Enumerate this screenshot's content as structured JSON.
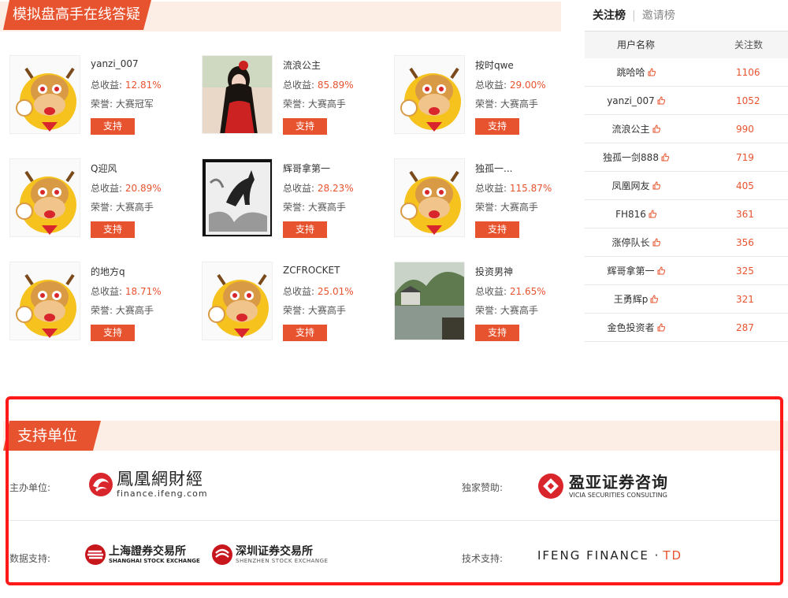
{
  "section_title": "模拟盘高手在线答疑",
  "labels": {
    "gain": "总收益:",
    "honor": "荣誉:"
  },
  "support_label": "支持",
  "cards": [
    {
      "name": "yanzi_007",
      "gain": "12.81%",
      "honor": "大赛冠军",
      "avatar": "cow-mascot"
    },
    {
      "name": "流浪公主",
      "gain": "85.89%",
      "honor": "大赛高手",
      "avatar": "photo-woman"
    },
    {
      "name": "按时qwe",
      "gain": "29.00%",
      "honor": "大赛高手",
      "avatar": "cow-mascot"
    },
    {
      "name": "Q迎风",
      "gain": "20.89%",
      "honor": "大赛高手",
      "avatar": "cow-mascot"
    },
    {
      "name": "辉哥拿第一",
      "gain": "28.23%",
      "honor": "大赛高手",
      "avatar": "horse-painting"
    },
    {
      "name": "独孤一...",
      "gain": "115.87%",
      "honor": "大赛高手",
      "avatar": "cow-mascot"
    },
    {
      "name": "的地方q",
      "gain": "18.71%",
      "honor": "大赛高手",
      "avatar": "cow-mascot"
    },
    {
      "name": "ZCFROCKET",
      "gain": "25.01%",
      "honor": "大赛高手",
      "avatar": "cow-mascot"
    },
    {
      "name": "投资男神",
      "gain": "21.65%",
      "honor": "大赛高手",
      "avatar": "photo-river"
    }
  ],
  "ranking": {
    "tab_active": "关注榜",
    "tab_other": "邀请榜",
    "col_name": "用户名称",
    "col_count": "关注数",
    "rows": [
      {
        "name": "跳哈哈",
        "count": "1106"
      },
      {
        "name": "yanzi_007",
        "count": "1052"
      },
      {
        "name": "流浪公主",
        "count": "990"
      },
      {
        "name": "独孤一剑888",
        "count": "719"
      },
      {
        "name": "凤凰网友",
        "count": "405"
      },
      {
        "name": "FH816",
        "count": "361"
      },
      {
        "name": "涨停队长",
        "count": "356"
      },
      {
        "name": "辉哥拿第一",
        "count": "325"
      },
      {
        "name": "王勇辉p",
        "count": "321"
      },
      {
        "name": "金色投资者",
        "count": "287"
      }
    ]
  },
  "support": {
    "title": "支持单位",
    "host_label": "主办单位:",
    "sponsor_label": "独家赞助:",
    "data_label": "数据支持:",
    "tech_label": "技术支持:",
    "ifeng_logo": "鳳凰網財經",
    "ifeng_url": "finance.ifeng.com",
    "vicia_logo": "盈亚证券咨询",
    "vicia_en": "VICIA SECURITIES CONSULTING",
    "sse_logo": "上海證券交易所",
    "sse_en": "SHANGHAI STOCK EXCHANGE",
    "szse_logo": "深圳证券交易所",
    "szse_en": "SHENZHEN STOCK EXCHANGE",
    "tech_logo_a": "IFENG FINANCE · ",
    "tech_logo_b": "TD"
  },
  "colors": {
    "accent": "#e8532f",
    "head_bg": "#fdeee5",
    "highlight": "#ff1a1a"
  }
}
